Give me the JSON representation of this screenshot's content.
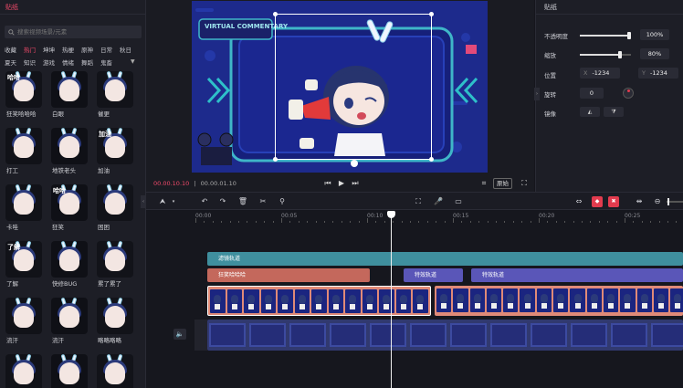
{
  "left_panel": {
    "title": "贴纸",
    "search_placeholder": "搜索视频场景/元素",
    "categories_row1": [
      "收藏",
      "热门",
      "坤坤",
      "热梗",
      "原神",
      "日常",
      "秋日"
    ],
    "categories_row2": [
      "夏天",
      "知识",
      "游戏",
      "情绪",
      "舞蹈",
      "鬼畜"
    ],
    "active_category": "热门",
    "stickers": [
      {
        "label": "狂笑哈哈哈",
        "thumb_text": "哈哈"
      },
      {
        "label": "白眼",
        "thumb_text": ""
      },
      {
        "label": "催更",
        "thumb_text": ""
      },
      {
        "label": "打工",
        "thumb_text": ""
      },
      {
        "label": "地铁老头",
        "thumb_text": ""
      },
      {
        "label": "加油",
        "thumb_text": "加油"
      },
      {
        "label": "卡哇",
        "thumb_text": ""
      },
      {
        "label": "狂笑",
        "thumb_text": "哈哈"
      },
      {
        "label": "困困",
        "thumb_text": ""
      },
      {
        "label": "了解",
        "thumb_text": "了解"
      },
      {
        "label": "快修BUG",
        "thumb_text": ""
      },
      {
        "label": "累了累了",
        "thumb_text": ""
      },
      {
        "label": "流汗",
        "thumb_text": ""
      },
      {
        "label": "流汗",
        "thumb_text": ""
      },
      {
        "label": "略略略略",
        "thumb_text": ""
      },
      {
        "label": "",
        "thumb_text": ""
      },
      {
        "label": "",
        "thumb_text": ""
      },
      {
        "label": "",
        "thumb_text": ""
      }
    ]
  },
  "preview": {
    "stage_title": "VIRTUAL COMMENTARY",
    "current_time": "00.00.10.10",
    "separator": "|",
    "total_time": "00.00.01.10",
    "original_label": "原始"
  },
  "right_panel": {
    "title": "贴纸",
    "opacity_label": "不透明度",
    "opacity_value": "100%",
    "opacity_fraction": 1.0,
    "scale_label": "缩放",
    "scale_value": "80%",
    "scale_fraction": 0.8,
    "position_label": "位置",
    "pos_x_label": "X",
    "pos_x": "-1234",
    "pos_y_label": "Y",
    "pos_y": "-1234",
    "rotate_label": "旋转",
    "rotate_value": "0",
    "mirror_label": "镜像"
  },
  "timeline": {
    "ticks": [
      "00:00",
      "00:05",
      "00:10",
      "00:15",
      "00:20",
      "00:25"
    ],
    "filter_track": "滤镜轨道",
    "sticker_track": "狂笑哈哈哈",
    "effect_track_1": "特效轨道",
    "effect_track_2": "特效轨道"
  },
  "colors": {
    "accent": "#f04a6a",
    "filter_track": "#3f8f9e",
    "sticker_track": "#c4685c",
    "effect_track": "#5a56b8",
    "video_track": "#e08a78",
    "audio_track": "#31396f"
  }
}
